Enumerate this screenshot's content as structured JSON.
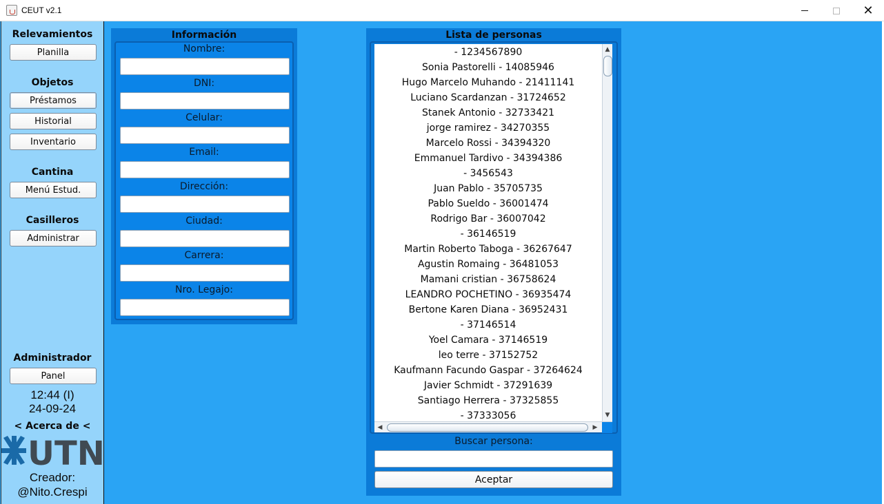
{
  "window": {
    "title": "CEUT v2.1"
  },
  "sidebar": {
    "relevamientos": {
      "heading": "Relevamientos",
      "buttons": [
        "Planilla"
      ]
    },
    "objetos": {
      "heading": "Objetos",
      "buttons": [
        "Préstamos",
        "Historial",
        "Inventario"
      ]
    },
    "cantina": {
      "heading": "Cantina",
      "buttons": [
        "Menú Estud."
      ]
    },
    "casilleros": {
      "heading": "Casilleros",
      "buttons": [
        "Administrar"
      ]
    },
    "administrador": {
      "heading": "Administrador",
      "buttons": [
        "Panel"
      ]
    },
    "clock": {
      "time": "12:44 (I)",
      "date": "24-09-24"
    },
    "about": "< Acerca de <",
    "logo_text": "UTN",
    "creator": {
      "label": "Creador:",
      "handle": "@Nito.Crespi"
    }
  },
  "info": {
    "title": "Información",
    "fields": [
      {
        "label": "Nombre:",
        "value": ""
      },
      {
        "label": "DNI:",
        "value": ""
      },
      {
        "label": "Celular:",
        "value": ""
      },
      {
        "label": "Email:",
        "value": ""
      },
      {
        "label": "Dirección:",
        "value": ""
      },
      {
        "label": "Ciudad:",
        "value": ""
      },
      {
        "label": "Carrera:",
        "value": ""
      },
      {
        "label": "Nro. Legajo:",
        "value": ""
      }
    ]
  },
  "people": {
    "title": "Lista de personas",
    "items": [
      " - 1234567890",
      "Sonia Pastorelli - 14085946",
      "Hugo Marcelo Muhando - 21411141",
      "Luciano Scardanzan - 31724652",
      "Stanek Antonio - 32733421",
      "jorge ramirez - 34270355",
      "Marcelo Rossi - 34394320",
      "Emmanuel Tardivo - 34394386",
      " - 3456543",
      "Juan Pablo - 35705735",
      "Pablo Sueldo - 36001474",
      "Rodrigo Bar - 36007042",
      " - 36146519",
      "Martin Roberto Taboga - 36267647",
      "Agustin Romaing - 36481053",
      "Mamani cristian - 36758624",
      "LEANDRO POCHETINO - 36935474",
      "Bertone Karen Diana - 36952431",
      " - 37146514",
      "Yoel Camara - 37146519",
      "leo terre - 37152752",
      "Kaufmann Facundo Gaspar - 37264624",
      "Javier Schmidt - 37291639",
      "Santiago Herrera - 37325855",
      " - 37333056"
    ],
    "search_label": "Buscar persona:",
    "search_value": "",
    "accept_label": "Aceptar"
  }
}
